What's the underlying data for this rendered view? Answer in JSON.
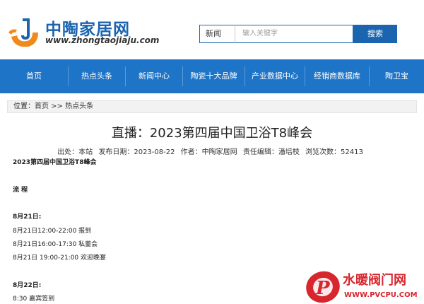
{
  "logo": {
    "name": "中陶家居网",
    "url": "www.zhongtaojiaju.com"
  },
  "search": {
    "category": "新闻",
    "placeholder": "输入关键字",
    "button": "搜索"
  },
  "nav": [
    "首页",
    "热点头条",
    "新闻中心",
    "陶瓷十大品牌",
    "产业数据中心",
    "经销商数据库",
    "陶卫宝"
  ],
  "breadcrumb": "位置：首页 >> 热点头条",
  "article": {
    "title": "直播：2023第四届中国卫浴T8峰会",
    "meta": {
      "source": "出处：本站",
      "date": "发布日期：2023-08-22",
      "author": "作者：中陶家居网",
      "editor": "责任编辑：潘培枝",
      "views": "浏览次数：52413"
    },
    "lines": [
      "2023第四届中国卫浴T8峰会",
      "流 程",
      "8月21日:",
      "8月21日12:00-22:00 报到",
      "8月21日16:00-17:30 私董会",
      "8月21日 19:00-21:00 欢迎晚宴",
      "8月22日:",
      "8:30 嘉宾签到"
    ]
  },
  "watermark": {
    "name": "水暖阀门网",
    "url": "WWW.PVCPU.COM"
  },
  "colors": {
    "brand": "#1a64b0",
    "nav": "#1e74c6",
    "watermark": "#d7262e"
  }
}
